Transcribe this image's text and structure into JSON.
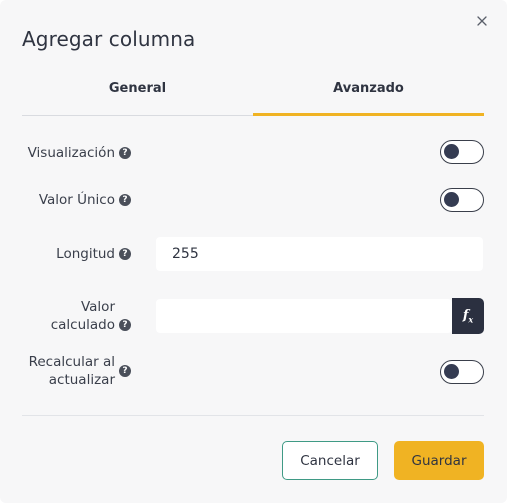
{
  "dialog": {
    "title": "Agregar columna",
    "close_icon": "close-icon"
  },
  "tabs": [
    {
      "label": "General",
      "active": false
    },
    {
      "label": "Avanzado",
      "active": true
    }
  ],
  "fields": {
    "visualizacion": {
      "label": "Visualización",
      "toggle_on": false
    },
    "valor_unico": {
      "label": "Valor Único",
      "toggle_on": false
    },
    "longitud": {
      "label": "Longitud",
      "value": "255"
    },
    "valor_calculado": {
      "label_line1": "Valor",
      "label_line2": "calculado",
      "value": "",
      "fx_icon": "function-icon"
    },
    "recalcular": {
      "label_line1": "Recalcular al",
      "label_line2": "actualizar",
      "toggle_on": false
    }
  },
  "help_icon": "question-circle-icon",
  "buttons": {
    "cancel": "Cancelar",
    "save": "Guardar"
  },
  "colors": {
    "accent": "#f0b323",
    "cancel_border": "#3f9a85",
    "fx_button": "#2b3040"
  }
}
